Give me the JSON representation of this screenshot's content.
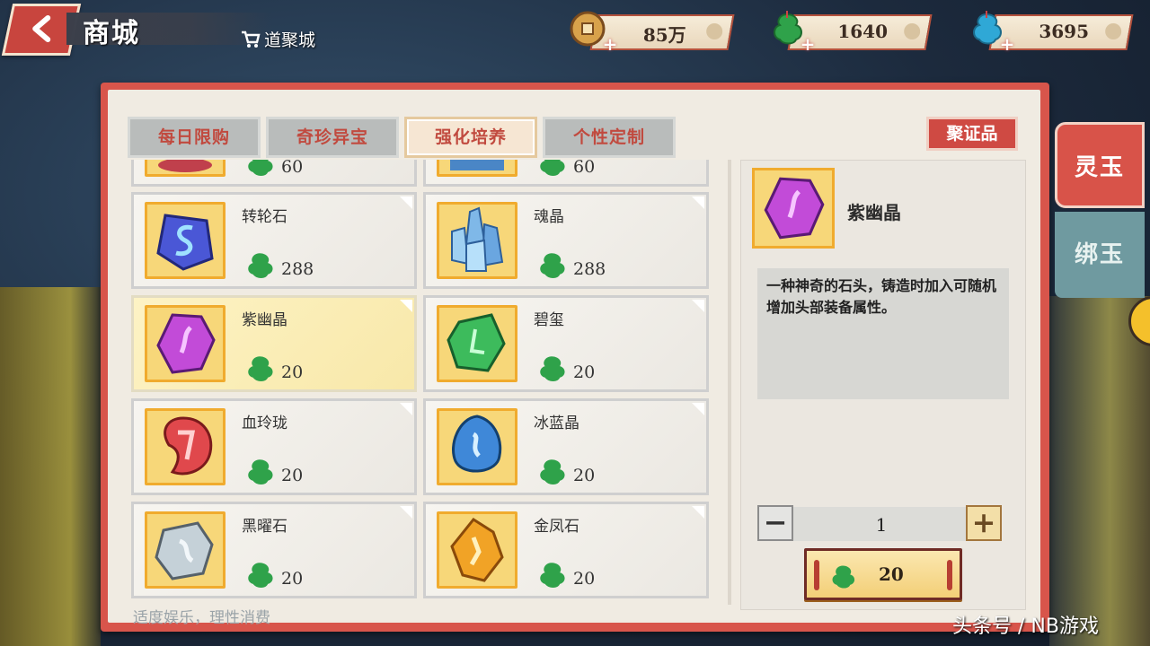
{
  "header": {
    "title": "商城",
    "breadcrumb": "道聚城"
  },
  "currencies": [
    {
      "name": "copper-coin",
      "value": "85万",
      "color": "#d8a24b"
    },
    {
      "name": "green-jade",
      "value": "1640",
      "color": "#2fa24a"
    },
    {
      "name": "blue-jade",
      "value": "3695",
      "color": "#2fa8d6"
    }
  ],
  "tabs": [
    {
      "label": "每日限购",
      "active": false
    },
    {
      "label": "奇珍异宝",
      "active": false
    },
    {
      "label": "强化培养",
      "active": true
    },
    {
      "label": "个性定制",
      "active": false
    }
  ],
  "cert_button": "聚证品",
  "items": [
    {
      "name": "",
      "price": "60",
      "color": "#c0404c"
    },
    {
      "name": "",
      "price": "60",
      "color": "#4a86c6"
    },
    {
      "name": "转轮石",
      "price": "288",
      "color": "#4a57d6"
    },
    {
      "name": "魂晶",
      "price": "288",
      "color": "#7fb8e8"
    },
    {
      "name": "紫幽晶",
      "price": "20",
      "color": "#c24bd8",
      "selected": true
    },
    {
      "name": "碧玺",
      "price": "20",
      "color": "#3dbb5c"
    },
    {
      "name": "血玲珑",
      "price": "20",
      "color": "#e0484c"
    },
    {
      "name": "冰蓝晶",
      "price": "20",
      "color": "#3f88d8"
    },
    {
      "name": "黑曜石",
      "price": "20",
      "color": "#c5d1d8"
    },
    {
      "name": "金凤石",
      "price": "20",
      "color": "#f1a326"
    }
  ],
  "notice": "适度娱乐，理性消费",
  "detail": {
    "name": "紫幽晶",
    "description": "一种神奇的石头，铸造时加入可随机增加头部装备属性。",
    "quantity": "1",
    "total_price": "20",
    "color": "#c24bd8"
  },
  "side_tabs": {
    "lingyu": "灵玉",
    "bangyu": "绑玉"
  },
  "watermark": "头条号 / NB游戏"
}
